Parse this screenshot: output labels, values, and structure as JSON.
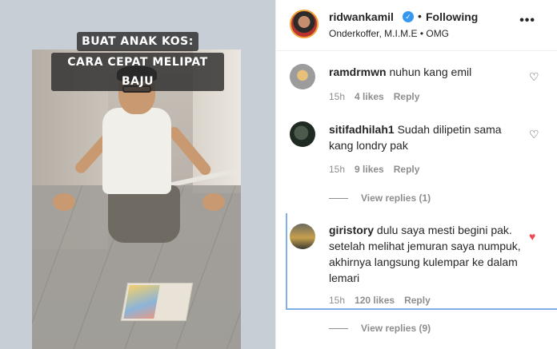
{
  "media": {
    "caption_line1": "BUAT ANAK KOS:",
    "caption_line2": "CARA CEPAT MELIPAT BAJU"
  },
  "header": {
    "username": "ridwankamil",
    "verified_icon": "verified-badge-icon",
    "separator": "•",
    "follow_label": "Following",
    "location": "Onderkoffer, M.I.M.E • OMG",
    "more_icon": "•••"
  },
  "comments": [
    {
      "username": "ramdrmwn",
      "text": "nuhun kang emil",
      "time": "15h",
      "likes": "4 likes",
      "reply": "Reply",
      "liked": false
    },
    {
      "username": "sitifadhilah1",
      "text": "Sudah dilipetin sama kang londry pak",
      "time": "15h",
      "likes": "9 likes",
      "reply": "Reply",
      "liked": false,
      "view_replies": "View replies (1)"
    },
    {
      "username": "giristory",
      "text": "dulu saya mesti begini pak. setelah melihat jemuran saya numpuk, akhirnya langsung kulempar ke dalam lemari",
      "time": "15h",
      "likes": "120 likes",
      "reply": "Reply",
      "liked": true,
      "view_replies": "View replies (9)"
    }
  ],
  "colors": {
    "liked_heart": "#ed4956",
    "verified": "#3897f0",
    "highlight": "#7fb0e8"
  }
}
